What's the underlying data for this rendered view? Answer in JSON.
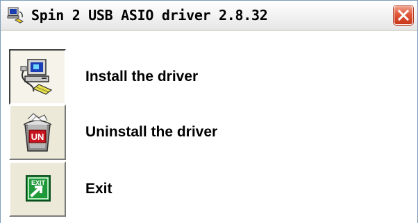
{
  "window": {
    "title": "Spin 2 USB ASIO driver 2.8.32",
    "title_icon": "computer-plug-icon",
    "close_icon": "close-icon"
  },
  "actions": [
    {
      "label": "Install the driver",
      "icon": "install-computer-icon",
      "pressed": true
    },
    {
      "label": "Uninstall the driver",
      "icon": "uninstall-trash-icon",
      "pressed": false,
      "icon_text": "UN"
    },
    {
      "label": "Exit",
      "icon": "exit-sign-icon",
      "pressed": false,
      "icon_text": "EXIT"
    }
  ],
  "colors": {
    "close_button": "#D9502F",
    "face": "#ECE9D8",
    "exit_green": "#1E9A3A",
    "uninstall_red": "#C8141E"
  }
}
